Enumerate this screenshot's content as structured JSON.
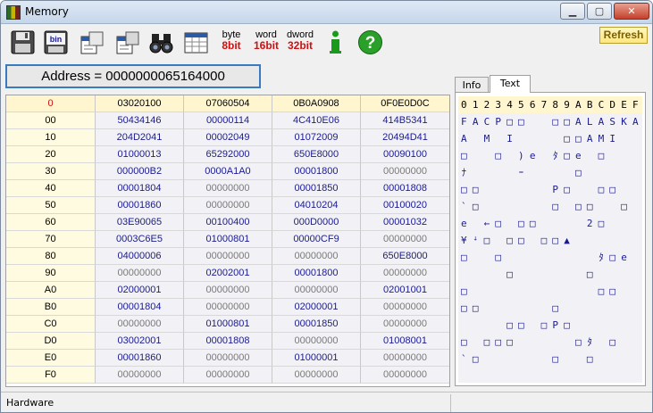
{
  "window": {
    "title": "Memory"
  },
  "toolbar": {
    "buttons": [
      {
        "name": "save-icon"
      },
      {
        "name": "save-binary-icon",
        "label": "bin"
      },
      {
        "name": "copy-page-icon"
      },
      {
        "name": "copy-page-2-icon"
      },
      {
        "name": "binoculars-icon"
      },
      {
        "name": "table-view-icon"
      }
    ],
    "byte": {
      "top": "byte",
      "bottom": "8bit"
    },
    "word": {
      "top": "word",
      "bottom": "16bit"
    },
    "dword": {
      "top": "dword",
      "bottom": "32bit"
    },
    "info_icon": "info-icon",
    "help_icon": "help-icon",
    "refresh_label": "Refresh"
  },
  "address": {
    "label": "Address = 0000000065164000"
  },
  "grid": {
    "header": [
      "0",
      "03020100",
      "07060504",
      "0B0A0908",
      "0F0E0D0C"
    ],
    "rows": [
      [
        "00",
        "50434146",
        "00000114",
        "4C410E06",
        "414B5341"
      ],
      [
        "10",
        "204D2041",
        "00002049",
        "01072009",
        "20494D41"
      ],
      [
        "20",
        "01000013",
        "65292000",
        "650E8000",
        "00090100"
      ],
      [
        "30",
        "000000B2",
        "0000A1A0",
        "00001800",
        "00000000"
      ],
      [
        "40",
        "00001804",
        "00000000",
        "00001850",
        "00001808"
      ],
      [
        "50",
        "00001860",
        "00000000",
        "04010204",
        "00100020"
      ],
      [
        "60",
        "03E90065",
        "00100400",
        "000D0000",
        "00001032"
      ],
      [
        "70",
        "0003C6E5",
        "01000801",
        "00000CF9",
        "00000000"
      ],
      [
        "80",
        "04000006",
        "00000000",
        "00000000",
        "650E8000"
      ],
      [
        "90",
        "00000000",
        "02002001",
        "00001800",
        "00000000"
      ],
      [
        "A0",
        "02000001",
        "00000000",
        "00000000",
        "02001001"
      ],
      [
        "B0",
        "00001804",
        "00000000",
        "02000001",
        "00000000"
      ],
      [
        "C0",
        "00000000",
        "01000801",
        "00001850",
        "00000000"
      ],
      [
        "D0",
        "03002001",
        "00001808",
        "00000000",
        "01008001"
      ],
      [
        "E0",
        "00001860",
        "00000000",
        "01000001",
        "00000000"
      ],
      [
        "F0",
        "00000000",
        "00000000",
        "00000000",
        "00000000"
      ]
    ]
  },
  "tabs": {
    "info": "Info",
    "text": "Text"
  },
  "text_view": {
    "header": "0123456789ABCDEF",
    "lines": [
      "FACP□□  □□ALASKA",
      "A M I    □□AMI  ",
      "□  □ )e ﾀ□e □   ",
      "ﾅ    ｰ    □     ",
      "□□      P□  □□  ",
      "`□      □ □□  □ ",
      "e ←□ □□    2□   ",
      "¥ꜜ□ □□ □□▲      ",
      "□  □        ﾀ□e ",
      "    □      □    ",
      "□           □□  ",
      "□□      □       ",
      "    □□ □P□      ",
      "□ □□□     □ﾀ □  ",
      "`□      □  □    ",
      "                "
    ]
  },
  "status": {
    "text": "Hardware"
  }
}
